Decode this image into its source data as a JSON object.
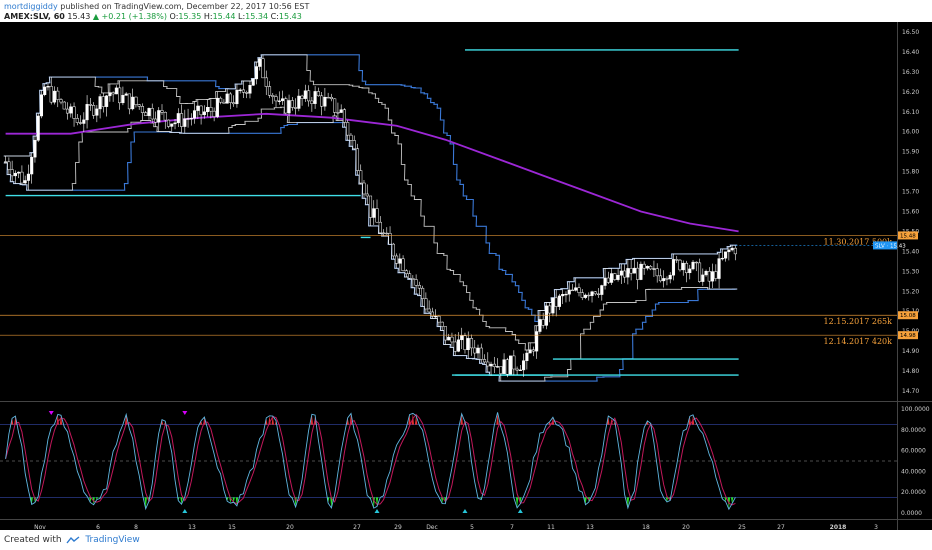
{
  "header": {
    "username": "mortdiggiddy",
    "published": "published on TradingView.com, December 22, 2017 10:56 EST",
    "symbol": "AMEX:SLV, 60",
    "last": "15.43",
    "change": "▲ +0.21 (+1.38%)",
    "o_label": "O:",
    "o": "15.35",
    "h_label": "H:",
    "h": "15.44",
    "l_label": "L:",
    "l": "15.34",
    "c_label": "C:",
    "c": "15.43"
  },
  "footer": {
    "created_with": "Created with",
    "brand": "TradingView"
  },
  "colors": {
    "background": "#000000",
    "up_candle": "#ffffff",
    "down_candle": "#ffffff",
    "ma": "#9c27d6",
    "channel_outer": "#3a78d6",
    "channel_inner": "#e6e6e6",
    "cyan_line": "#40e0e8",
    "annotation": "#f7a23b",
    "stoch_k": "#5fb6e0",
    "stoch_d": "#c2185b",
    "overbought_fill": "#e23030",
    "oversold_fill": "#26e026",
    "triangle_up": "#26c6da",
    "triangle_down": "#d500f9"
  },
  "chart_data": [
    {
      "type": "candlestick",
      "title": "AMEX:SLV, 60",
      "y_ticks": [
        "16.50",
        "16.40",
        "16.30",
        "16.20",
        "16.10",
        "16.00",
        "15.90",
        "15.80",
        "15.70",
        "15.60",
        "15.50",
        "15.40",
        "15.30",
        "15.20",
        "15.10",
        "15.00",
        "14.90",
        "14.80",
        "14.70"
      ],
      "ylim": [
        14.65,
        16.55
      ],
      "x_ticks": [
        "Nov",
        "6",
        "8",
        "13",
        "15",
        "20",
        "27",
        "29",
        "Dec",
        "5",
        "7",
        "11",
        "13",
        "18",
        "20",
        "25",
        "27",
        "2018",
        "3"
      ],
      "price_label": "SLV · 15.43",
      "last_price": 15.43,
      "axis_markers": [
        "15.48",
        "15.08",
        "14.98"
      ],
      "annotations": [
        {
          "text": "11.30.2017 500k",
          "price": 15.48
        },
        {
          "text": "12.15.2017 265k",
          "price": 15.08
        },
        {
          "text": "12.14.2017 420k",
          "price": 14.98
        }
      ],
      "ma_series": [
        [
          0,
          15.99
        ],
        [
          20,
          15.99
        ],
        [
          40,
          16.04
        ],
        [
          60,
          16.07
        ],
        [
          80,
          16.09
        ],
        [
          100,
          16.07
        ],
        [
          120,
          16.03
        ],
        [
          135,
          15.96
        ],
        [
          150,
          15.87
        ],
        [
          165,
          15.78
        ],
        [
          180,
          15.69
        ],
        [
          195,
          15.6
        ],
        [
          210,
          15.54
        ],
        [
          225,
          15.5
        ]
      ],
      "cyan_levels": [
        {
          "from": 0,
          "to": 109,
          "price": 15.68
        },
        {
          "from": 109,
          "to": 112,
          "price": 15.47
        },
        {
          "from": 137,
          "to": 168,
          "price": 14.78
        },
        {
          "from": 168,
          "to": 225,
          "price": 14.86
        },
        {
          "from": 138,
          "to": 225,
          "price": 14.78
        },
        {
          "from": 141,
          "to": 225,
          "price": 16.41
        }
      ]
    },
    {
      "type": "line",
      "title": "Stochastic",
      "y_ticks": [
        "100.0000",
        "80.0000",
        "60.0000",
        "40.0000",
        "20.0000",
        "0.0000"
      ],
      "ylim": [
        0,
        100
      ],
      "levels": [
        85,
        50,
        15
      ]
    }
  ]
}
